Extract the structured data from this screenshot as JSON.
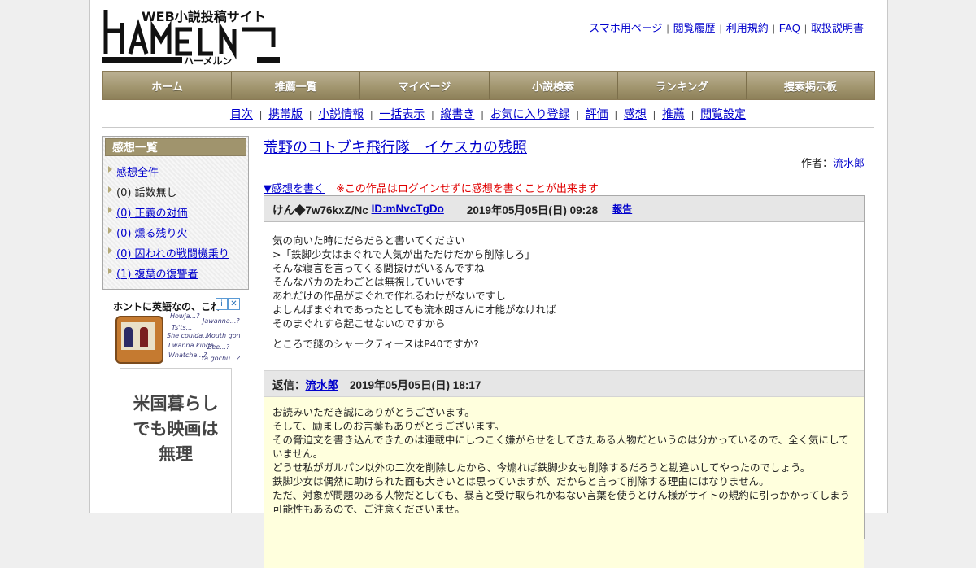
{
  "header": {
    "logo_caption": "WEB小説投稿サイト",
    "logo_word": "HAMELN",
    "logo_kana": "ハーメルン",
    "toplinks": [
      "スマホ用ページ",
      "閲覧履歴",
      "利用規約",
      "FAQ",
      "取扱説明書"
    ]
  },
  "mainnav": [
    "ホーム",
    "推薦一覧",
    "マイページ",
    "小説検索",
    "ランキング",
    "捜索掲示板"
  ],
  "subnav": [
    "目次",
    "携帯版",
    "小説情報",
    "一括表示",
    "縦書き",
    "お気に入り登録",
    "評価",
    "感想",
    "推薦",
    "閲覧設定"
  ],
  "sidebar": {
    "title": "感想一覧",
    "items": [
      {
        "label": "感想全件",
        "link": true
      },
      {
        "label": "(0) 話数無し",
        "link": false
      },
      {
        "label": "(0) 正義の対価",
        "link": true
      },
      {
        "label": "(0) 燻る残り火",
        "link": true
      },
      {
        "label": "(0) 囚われの戦闘機乗り",
        "link": true
      },
      {
        "label": "(1) 複葉の復讐者",
        "link": true
      }
    ]
  },
  "ad": {
    "title": "ホントに英語なの、これ",
    "bubbles": [
      "Howja...?",
      "Jawanna...?",
      "Ts'ts...",
      "She coulda...",
      "Mouth gonna...",
      "I wanna kinda...",
      "Zee...?",
      "Whatcha...?",
      "Ya gochu...?"
    ],
    "lines": [
      "米国暮らし",
      "でも映画は",
      "無理"
    ],
    "badge_info": "i",
    "badge_close": "✕"
  },
  "main": {
    "title": "荒野のコトブキ飛行隊　イケスカの残照",
    "author_label": "作者：",
    "author_name": "流水郎",
    "write_link": "▼感想を書く",
    "warning": "※この作品はログインせずに感想を書くことが出来ます",
    "comment": {
      "user": "けん◆7w76kxZ/Nc",
      "id": "ID:mNvcTgDo",
      "date": "2019年05月05日(日) 09:28",
      "report": "報告",
      "lines": [
        "気の向いた時にだらだらと書いてください",
        ">「鉄脚少女はまぐれで人気が出ただけだから削除しろ」",
        "そんな寝言を言ってくる間抜けがいるんですね",
        "そんなバカのたわごとは無視していいです",
        "あれだけの作品がまぐれで作れるわけがないですし",
        "よしんばまぐれであったとしても流水朗さんに才能がなければ",
        "そのまぐれすら起こせないのですから"
      ],
      "last_line": "ところで謎のシャークティースはP40ですか?"
    },
    "reply": {
      "label": "返信：",
      "name": "流水郎",
      "date": "2019年05月05日(日) 18:17",
      "lines": [
        "お読みいただき誠にありがとうございます。",
        "そして、励ましのお言葉もありがとうございます。",
        "その脅迫文を書き込んできたのは連載中にしつこく嫌がらせをしてきたある人物だというのは分かっているので、全く気にしていません。",
        "どうせ私がガルパン以外の二次を削除したから、今煽れば鉄脚少女も削除するだろうと勘違いしてやったのでしょう。",
        "鉄脚少女は偶然に助けられた面も大きいとは思っていますが、だからと言って削除する理由にはなりません。",
        "ただ、対象が問題のある人物だとしても、暴言と受け取られかねない言葉を使うとけん様がサイトの規約に引っかかってしまう可能性もあるので、ご注意くださいませ。"
      ]
    }
  }
}
